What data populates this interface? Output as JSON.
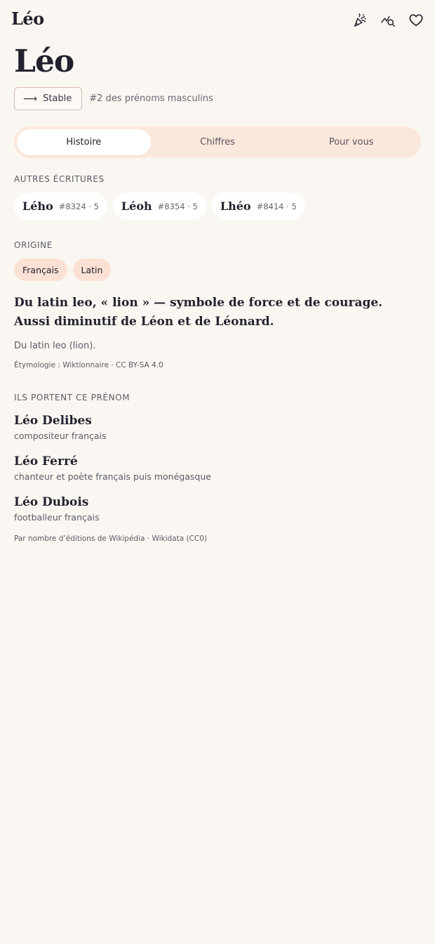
{
  "app": {
    "logo": "Léo"
  },
  "header_icons": [
    "party-popper-icon",
    "chart-search-icon",
    "heart-icon"
  ],
  "name": {
    "title": "Léo"
  },
  "trend": {
    "arrow": "⟶",
    "label": "Stable",
    "rank": "#2 des prénoms masculins"
  },
  "tabs": [
    {
      "label": "Histoire",
      "active": true
    },
    {
      "label": "Chiffres",
      "active": false
    },
    {
      "label": "Pour vous",
      "active": false
    }
  ],
  "variants_section": {
    "title": "AUTRES ÉCRITURES",
    "items": [
      {
        "name": "Lého",
        "meta": "#8324 · 5"
      },
      {
        "name": "Léoh",
        "meta": "#8354 · 5"
      },
      {
        "name": "Lhéo",
        "meta": "#8414 · 5"
      }
    ]
  },
  "origin_section": {
    "title": "ORIGINE",
    "chips": [
      "Français",
      "Latin"
    ],
    "main": "Du latin leo, « lion » — symbole de force et de courage. Aussi diminutif de Léon et de Léonard.",
    "short": "Du latin leo (lion).",
    "source": "Étymologie : Wiktionnaire · CC BY-SA 4.0"
  },
  "people_section": {
    "title": "ILS PORTENT CE PRÉNOM",
    "people": [
      {
        "name": "Léo Delibes",
        "desc": "compositeur français"
      },
      {
        "name": "Léo Ferré",
        "desc": "chanteur et poète français puis monégasque"
      },
      {
        "name": "Léo Dubois",
        "desc": "footballeur français"
      }
    ],
    "source": "Par nombre d’éditions de Wikipédia · Wikidata (CC0)"
  },
  "colors": {
    "background": "#faf7f2",
    "text": "#25202e",
    "tab_track": "#fbe8dc",
    "chip": "#fbe1d4",
    "badge_border": "#d9b8b2"
  }
}
